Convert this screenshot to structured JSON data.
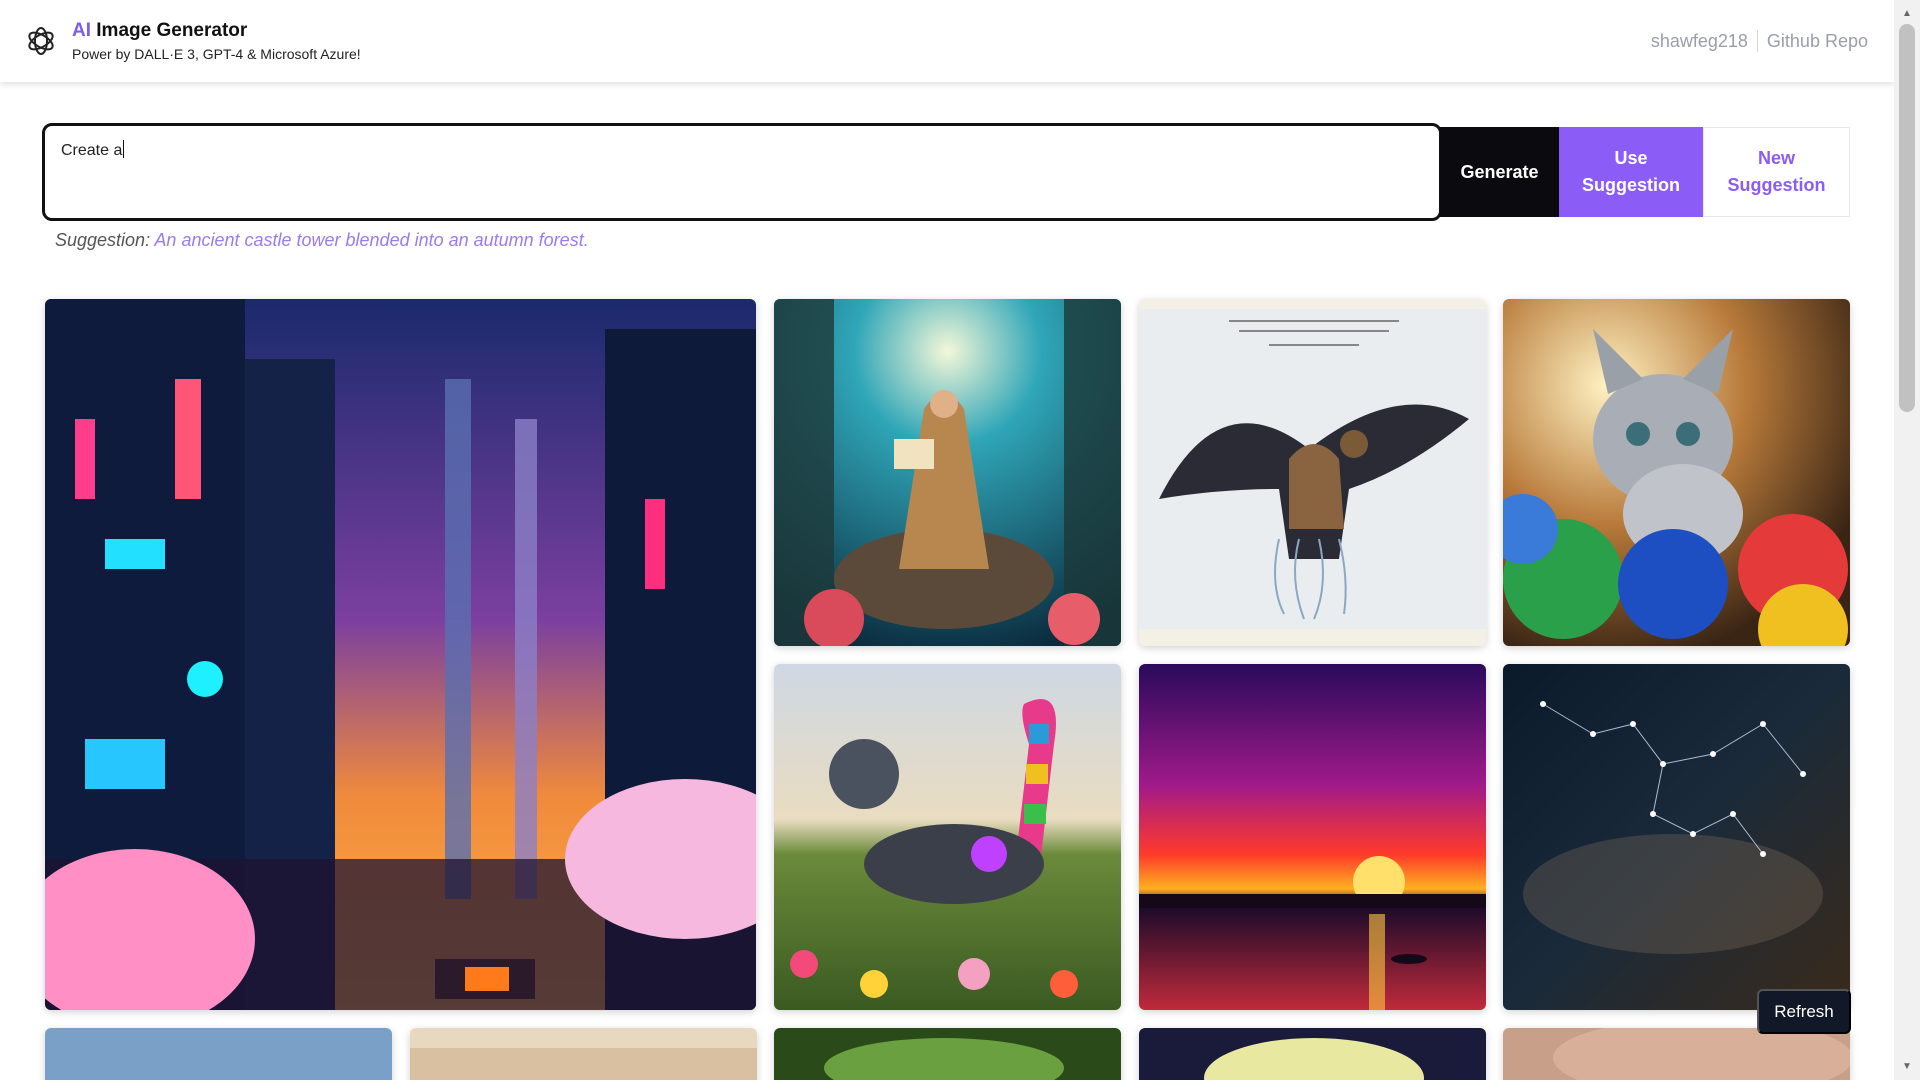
{
  "header": {
    "title_ai": "AI",
    "title_rest": " Image Generator",
    "subtitle": "Power by DALL·E 3, GPT-4 & Microsoft Azure!",
    "nav": [
      {
        "label": "shawfeg218"
      },
      {
        "label": "Github Repo"
      }
    ]
  },
  "prompt": {
    "value": "Create a"
  },
  "buttons": {
    "generate": "Generate",
    "use_suggestion_line1": "Use",
    "use_suggestion_line2": "Suggestion",
    "new_suggestion_line1": "New",
    "new_suggestion_line2": "Suggestion",
    "refresh": "Refresh"
  },
  "suggestion": {
    "label": "Suggestion:",
    "text": "An ancient castle tower blended into an autumn forest."
  },
  "colors": {
    "accent": "#8b5cf6",
    "dark": "#0b0b0f"
  },
  "gallery": [
    {
      "name": "cyberpunk-city-image"
    },
    {
      "name": "underwater-reader-image"
    },
    {
      "name": "hawk-jellyfish-image"
    },
    {
      "name": "kitten-yarn-image"
    },
    {
      "name": "robot-cat-flowers-image"
    },
    {
      "name": "sunset-lake-image"
    },
    {
      "name": "constellation-sky-image"
    },
    {
      "name": "sky-image"
    },
    {
      "name": "desert-image"
    },
    {
      "name": "forest-image"
    },
    {
      "name": "moon-image"
    },
    {
      "name": "portrait-image"
    }
  ]
}
